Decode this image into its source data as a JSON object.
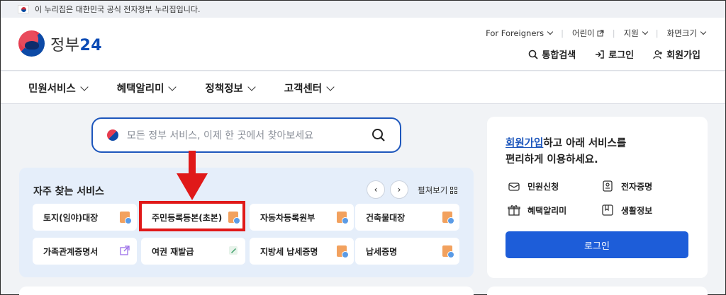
{
  "topbar": {
    "notice": "이 누리집은 대한민국 공식 전자정부 누리집입니다."
  },
  "header": {
    "logo_text": "정부",
    "logo_num": "24",
    "util": [
      "For Foreigners",
      "어린이",
      "지원",
      "화면크기"
    ],
    "actions": [
      "통합검색",
      "로그인",
      "회원가입"
    ]
  },
  "nav": {
    "items": [
      "민원서비스",
      "혜택알리미",
      "정책정보",
      "고객센터"
    ]
  },
  "search": {
    "placeholder": "모든 정부 서비스, 이제 한 곳에서 찾아보세요"
  },
  "favorites": {
    "title": "자주 찾는 서비스",
    "expand_label": "펼쳐보기",
    "cards": [
      "토지(임야)대장",
      "주민등록등본(초본)",
      "자동차등록원부",
      "건축물대장",
      "가족관계증명서",
      "여권 재발급",
      "지방세 납세증명",
      "납세증명"
    ]
  },
  "sidebar": {
    "intro_link": "회원가입",
    "intro_rest": "하고 아래 서비스를",
    "intro_line2": "편리하게 이용하세요.",
    "services": [
      "민원신청",
      "전자증명",
      "혜택알리미",
      "생활정보"
    ],
    "login_button": "로그인"
  },
  "colors": {
    "brand_blue": "#1d56bc",
    "button_blue": "#1d5dd9",
    "highlight_red": "#e01919"
  }
}
